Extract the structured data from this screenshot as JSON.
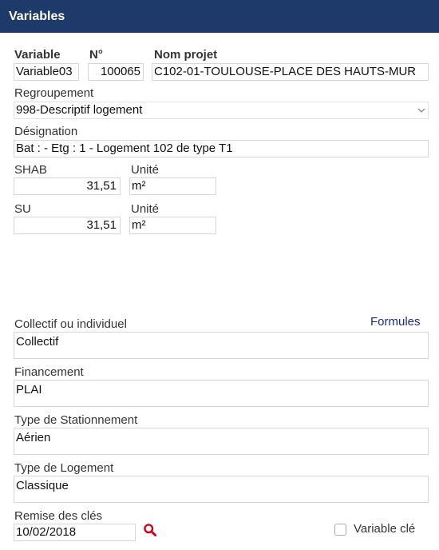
{
  "window": {
    "title": "Variables"
  },
  "header_fields": {
    "variable_label": "Variable",
    "variable_value": "Variable03",
    "numero_label": "N°",
    "numero_value": "100065",
    "nom_projet_label": "Nom projet",
    "nom_projet_value": "C102-01-TOULOUSE-PLACE DES HAUTS-MUR"
  },
  "regroupement": {
    "label": "Regroupement",
    "value": "998-Descriptif logement"
  },
  "designation": {
    "label": "Désignation",
    "value": "Bat :  - Etg : 1 - Logement 102 de type T1"
  },
  "shab": {
    "label": "SHAB",
    "value": "31,51",
    "unit_label": "Unité",
    "unit_value": "m²"
  },
  "su": {
    "label": "SU",
    "value": "31,51",
    "unit_label": "Unité",
    "unit_value": "m²"
  },
  "formules_link": "Formules",
  "collectif": {
    "label": "Collectif ou individuel",
    "value": "Collectif"
  },
  "financement": {
    "label": "Financement",
    "value": "PLAI"
  },
  "stationnement": {
    "label": "Type de Stationnement",
    "value": "Aérien"
  },
  "logement": {
    "label": "Type de Logement",
    "value": "Classique"
  },
  "remise": {
    "label": "Remise des clés",
    "value": "10/02/2018"
  },
  "variable_cle": {
    "label": "Variable clé",
    "checked": false
  },
  "colors": {
    "titlebar": "#1e3a6b",
    "link": "#1a2b86",
    "search_icon": "#d0021b"
  },
  "icons": {
    "search": "search-icon",
    "dropdown": "chevron-down-icon"
  }
}
